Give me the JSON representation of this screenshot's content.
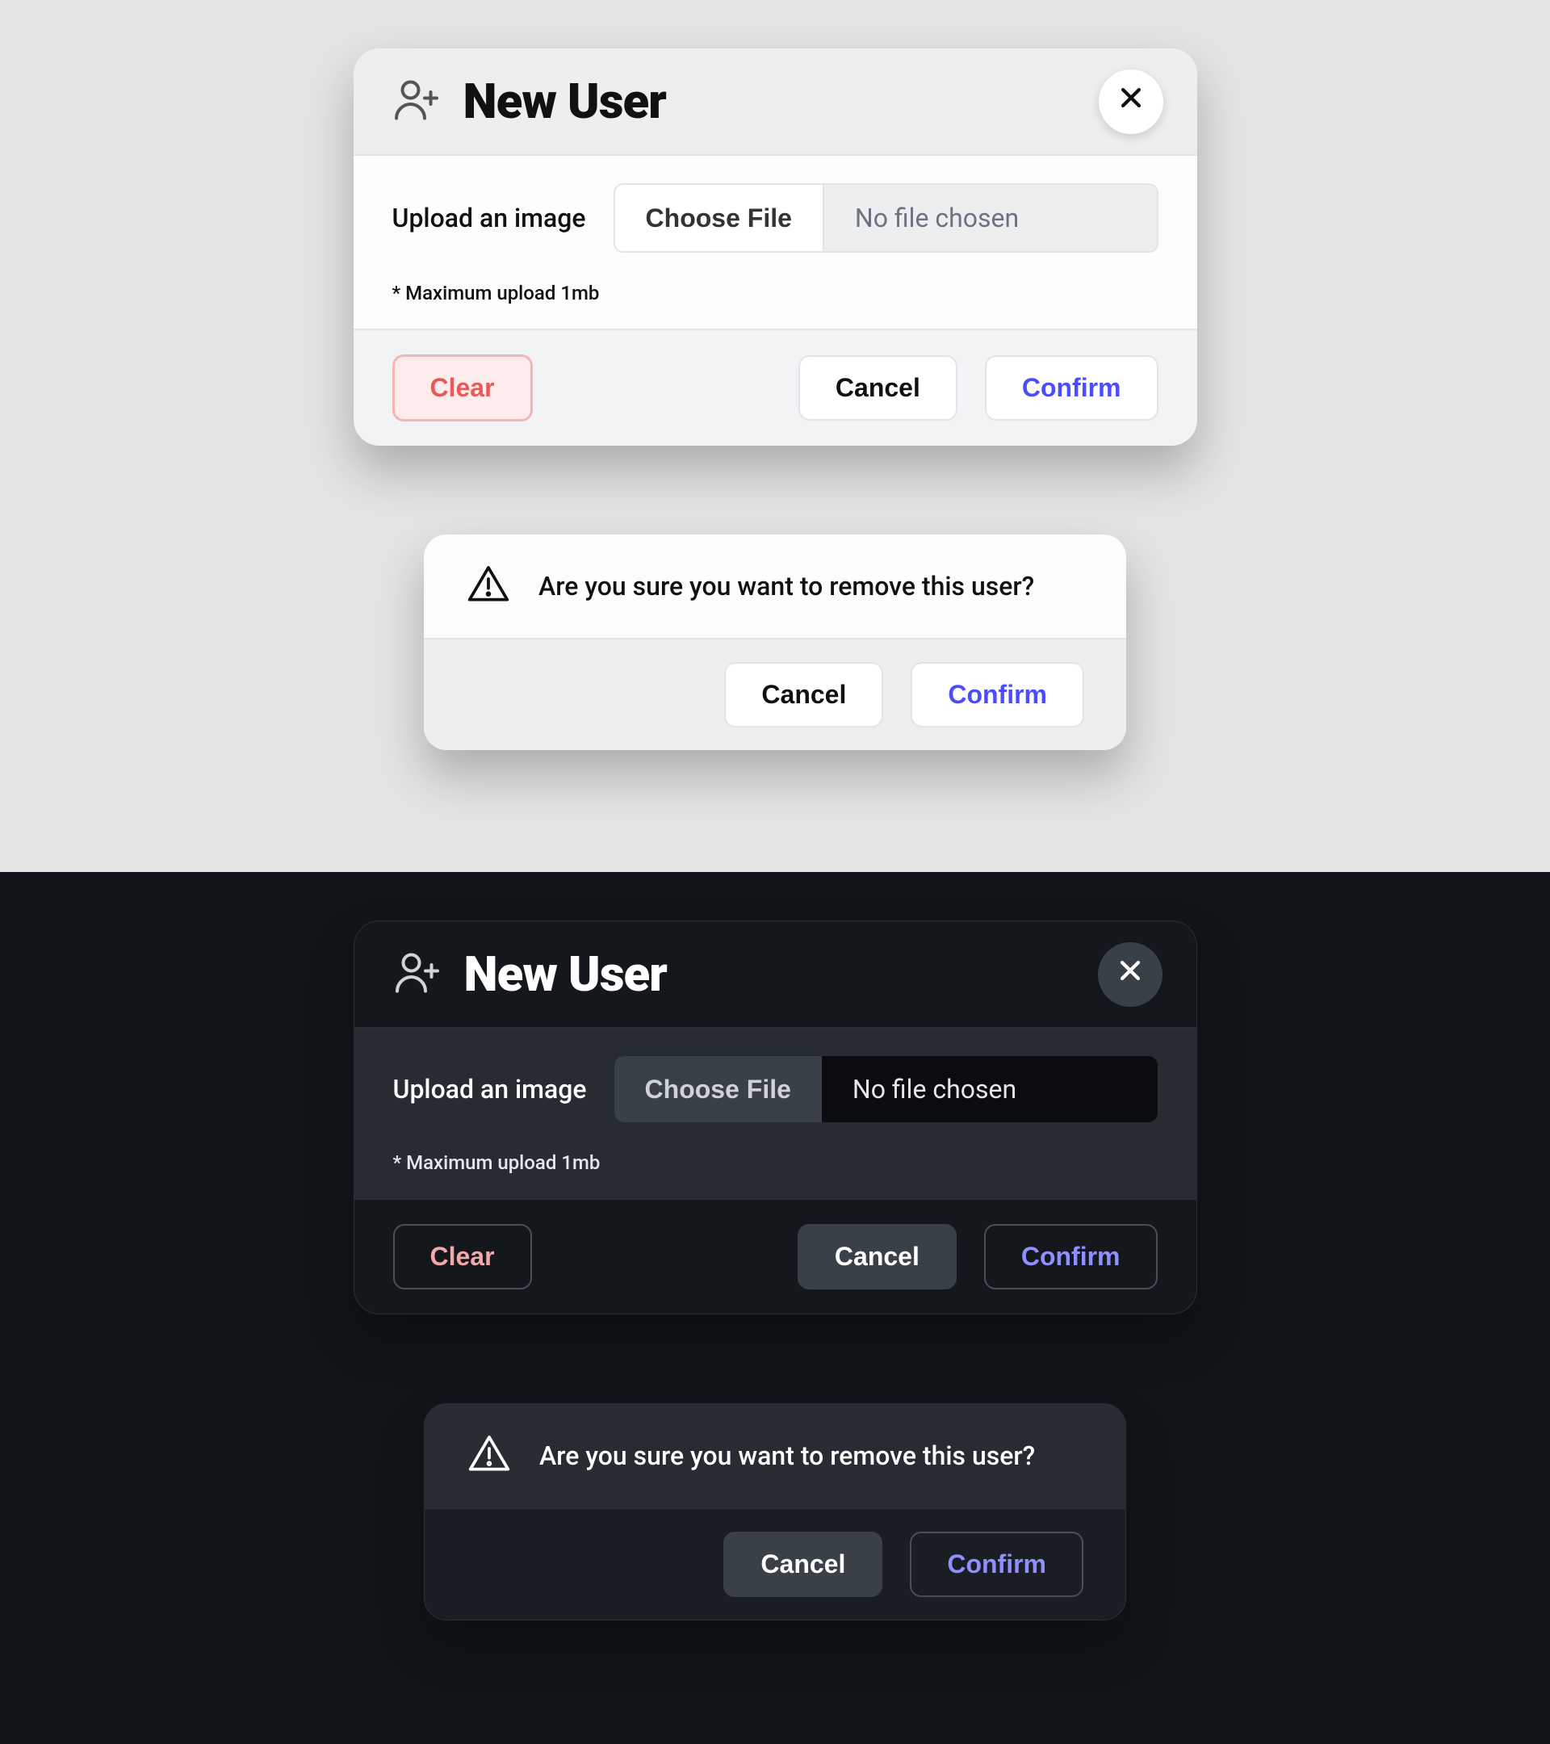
{
  "newUser": {
    "title": "New User",
    "uploadLabel": "Upload an image",
    "chooseFile": "Choose File",
    "fileStatus": "No file chosen",
    "uploadNote": "* Maximum upload 1mb",
    "clear": "Clear",
    "cancel": "Cancel",
    "confirm": "Confirm"
  },
  "removeAlert": {
    "message": "Are you sure you want to remove this user?",
    "cancel": "Cancel",
    "confirm": "Confirm"
  }
}
